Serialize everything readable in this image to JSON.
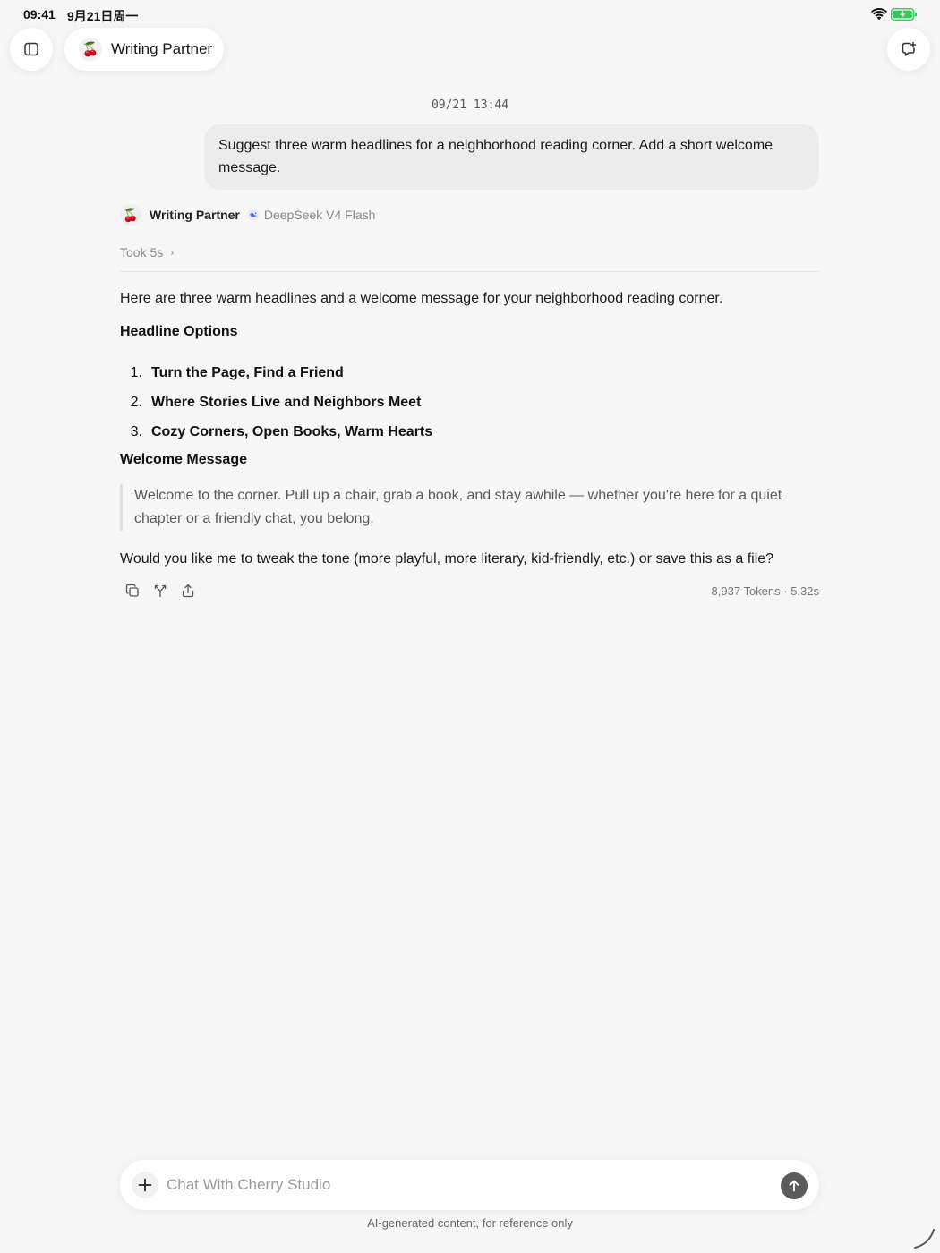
{
  "status_bar": {
    "time": "09:41",
    "date": "9月21日周一",
    "battery_color": "#34c759"
  },
  "header": {
    "assistant_name": "Writing Partner",
    "assistant_emoji": "🍒"
  },
  "conversation": {
    "timestamp": "09/21 13:44",
    "user_message": "Suggest three warm headlines for a neighborhood reading corner. Add a short welcome message.",
    "assistant": {
      "name": "Writing Partner",
      "emoji": "🍒",
      "model": "DeepSeek V4 Flash",
      "thinking_label": "Took 5s",
      "intro": "Here are three warm headlines and a welcome message for your neighborhood reading corner.",
      "headlines_heading": "Headline Options",
      "headlines": [
        {
          "num": "1.",
          "text": "Turn the Page, Find a Friend"
        },
        {
          "num": "2.",
          "text": "Where Stories Live and Neighbors Meet"
        },
        {
          "num": "3.",
          "text": "Cozy Corners, Open Books, Warm Hearts"
        }
      ],
      "welcome_heading": "Welcome Message",
      "welcome_quote": "Welcome to the corner. Pull up a chair, grab a book, and stay awhile — whether you're here for a quiet chapter or a friendly chat, you belong.",
      "closing": "Would you like me to tweak the tone (more playful, more literary, kid-friendly, etc.) or save this as a file?",
      "stats": "8,937 Tokens · 5.32s"
    }
  },
  "composer": {
    "placeholder": "Chat With Cherry Studio",
    "value": ""
  },
  "footer": {
    "disclaimer": "AI-generated content, for reference only"
  }
}
